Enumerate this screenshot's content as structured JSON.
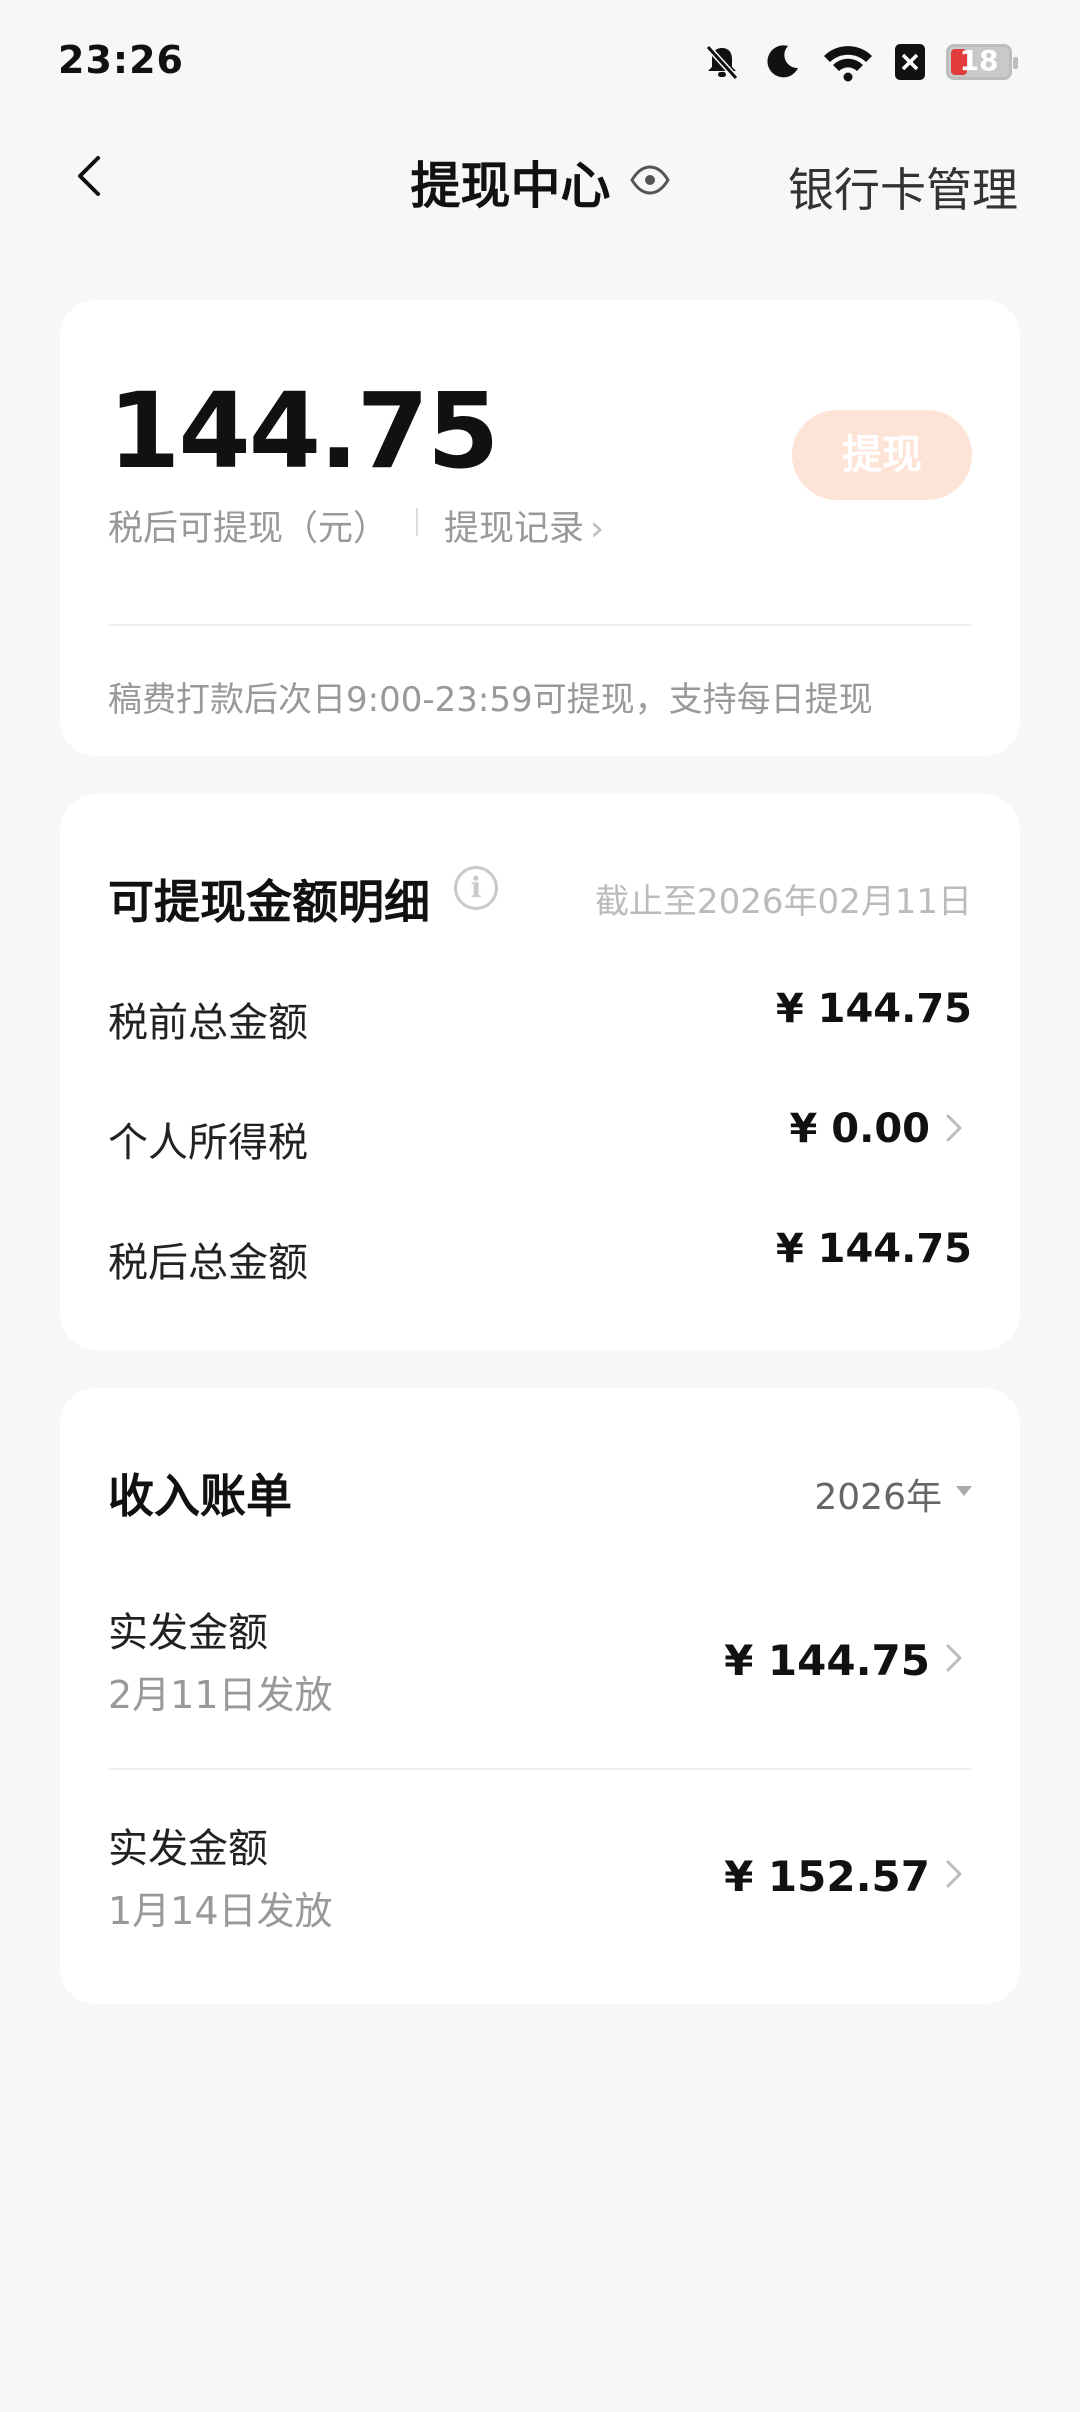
{
  "status_bar": {
    "time": "23:26",
    "battery_level": "18",
    "icons": [
      "bell-off-icon",
      "moon-icon",
      "wifi-icon",
      "close-box-icon",
      "battery-icon"
    ]
  },
  "header": {
    "title": "提现中心",
    "bank_link": "银行卡管理"
  },
  "balance_card": {
    "amount": "144.75",
    "amount_label": "税后可提现（元）",
    "record_link": "提现记录",
    "withdraw_button": "提现",
    "notice": "稿费打款后次日9:00-23:59可提现，支持每日提现"
  },
  "detail_card": {
    "title": "可提现金额明细",
    "cutoff": "截止至2026年02月11日",
    "rows": [
      {
        "label": "税前总金额",
        "value": "¥ 144.75"
      },
      {
        "label": "个人所得税",
        "value": "¥ 0.00"
      },
      {
        "label": "税后总金额",
        "value": "¥ 144.75"
      }
    ]
  },
  "bill_card": {
    "title": "收入账单",
    "year": "2026年",
    "items": [
      {
        "title": "实发金额",
        "date": "2月11日发放",
        "amount": "¥ 144.75"
      },
      {
        "title": "实发金额",
        "date": "1月14日发放",
        "amount": "¥ 152.57"
      }
    ]
  },
  "colors": {
    "background": "#f7f7f7",
    "card": "#ffffff",
    "withdraw_button_bg": "#fde4d6",
    "battery_low": "#e23b3b"
  }
}
